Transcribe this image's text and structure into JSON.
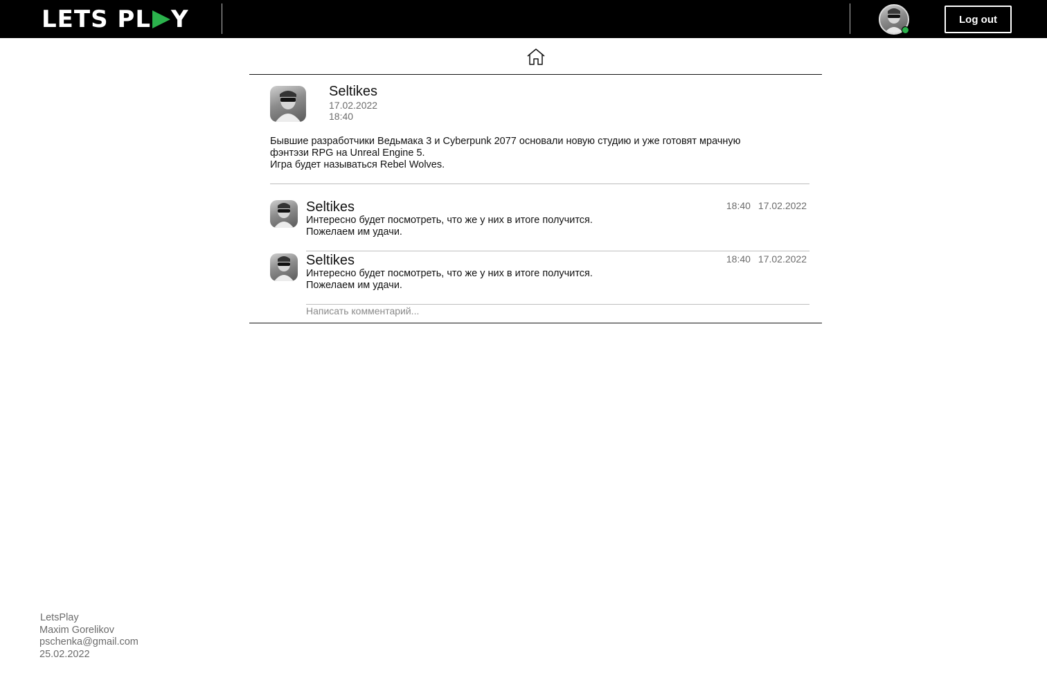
{
  "header": {
    "logo_part1": "LETS PL",
    "logo_part2": "Y",
    "logout_label": "Log out"
  },
  "colors": {
    "header_bg": "#000000",
    "accent": "#2bb24c",
    "muted_text": "#6b6b6b"
  },
  "icons": {
    "home": "home-icon",
    "play": "play-triangle-icon"
  },
  "post": {
    "author": "Seltikes",
    "date": "17.02.2022",
    "time": "18:40",
    "text_lines": [
      "Бывшие разработчики Ведьмака 3 и  Cyberpunk 2077 основали новую студию и уже готовят мрачную",
      "фэнтэзи RPG на Unreal Engine 5.",
      "Игра будет называться Rebel Wolves."
    ]
  },
  "comments": [
    {
      "author": "Seltikes",
      "time": "18:40",
      "date": "17.02.2022",
      "lines": [
        "Интересно будет посмотреть, что же у них в итоге получится.",
        "Пожелаем им удачи."
      ]
    },
    {
      "author": "Seltikes",
      "time": "18:40",
      "date": "17.02.2022",
      "lines": [
        "Интересно будет посмотреть, что же у них в итоге получится.",
        "Пожелаем им удачи."
      ]
    }
  ],
  "comment_input": {
    "placeholder": "Написать комментарий..."
  },
  "footer": {
    "site": "LetsPlay",
    "author": "Maxim Gorelikov",
    "email": "pschenka@gmail.com",
    "date": "25.02.2022"
  }
}
